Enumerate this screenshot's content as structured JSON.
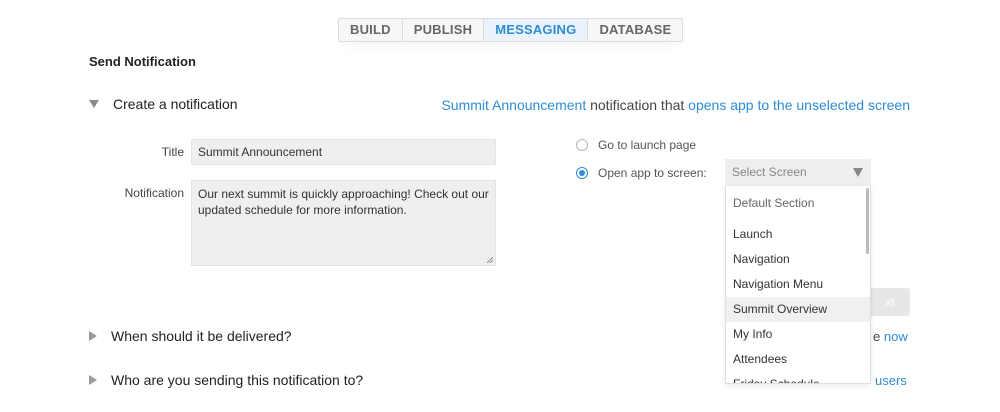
{
  "tabs": [
    {
      "label": "BUILD"
    },
    {
      "label": "PUBLISH"
    },
    {
      "label": "MESSAGING",
      "active": true
    },
    {
      "label": "DATABASE"
    }
  ],
  "page_title": "Send Notification",
  "sections": {
    "create": "Create a notification",
    "delivery": "When should it be delivered?",
    "audience": "Who are you sending this notification to?"
  },
  "summary": {
    "title_link": "Summit Announcement",
    "middle": "notification that",
    "action_link": "opens app to the unselected screen"
  },
  "form": {
    "title_label": "Title",
    "title_value": "Summit Announcement",
    "notification_label": "Notification",
    "notification_value": "Our next summit is quickly approaching! Check out our updated schedule for more information."
  },
  "options": {
    "launch_label": "Go to launch page",
    "screen_label": "Open app to screen:",
    "selected": "screen"
  },
  "select": {
    "placeholder": "Select Screen",
    "items": [
      "Default Section",
      "Launch",
      "Navigation",
      "Navigation Menu",
      "Summit Overview",
      "My Info",
      "Attendees",
      "Friday Schedule"
    ],
    "hover_index": 4
  },
  "next_button": "xt",
  "delivery_partial": {
    "prefix": "e",
    "link": "now"
  },
  "audience_partial": {
    "link": "users"
  },
  "colors": {
    "accent": "#2f8cd2",
    "input_bg": "#efefef"
  }
}
